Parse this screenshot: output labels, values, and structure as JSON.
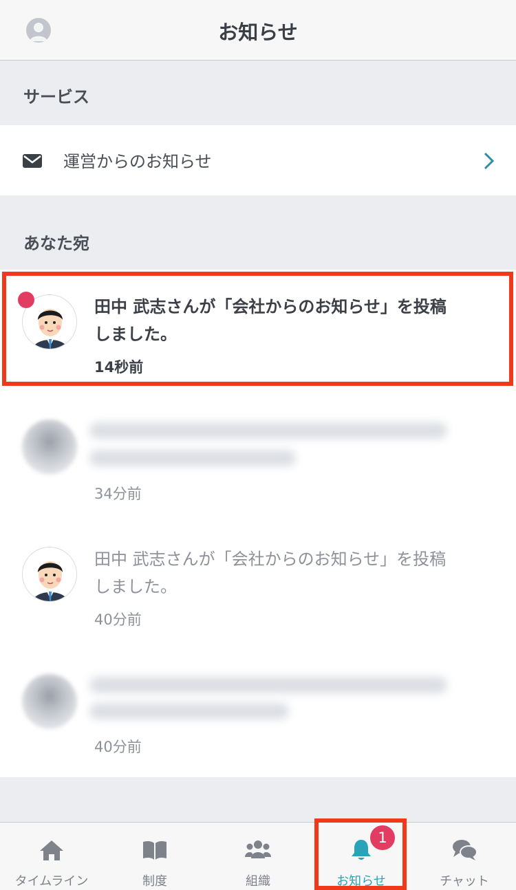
{
  "header": {
    "title": "お知らせ"
  },
  "sections": {
    "service": {
      "label": "サービス",
      "row_label": "運営からのお知らせ"
    },
    "mine": {
      "label": "あなた宛"
    }
  },
  "notifications": [
    {
      "text": "田中 武志さんが「会社からのお知らせ」を投稿しました。",
      "line1": "田中 武志さんが「会社からのお知らせ」を投稿",
      "line2": "しました。",
      "time": "14秒前",
      "unread": true
    },
    {
      "text": "",
      "time": "34分前",
      "unread": false,
      "blurred": true
    },
    {
      "text": "田中 武志さんが「会社からのお知らせ」を投稿しました。",
      "line1": "田中 武志さんが「会社からのお知らせ」を投稿",
      "line2": "しました。",
      "time": "40分前",
      "unread": false
    },
    {
      "text": "",
      "time": "40分前",
      "unread": false,
      "blurred": true
    }
  ],
  "tabbar": {
    "tabs": [
      {
        "label": "タイムライン",
        "icon": "home-icon"
      },
      {
        "label": "制度",
        "icon": "book-icon"
      },
      {
        "label": "組織",
        "icon": "group-icon"
      },
      {
        "label": "お知らせ",
        "icon": "bell-icon",
        "active": true,
        "badge": "1"
      },
      {
        "label": "チャット",
        "icon": "chat-icon"
      }
    ]
  },
  "colors": {
    "accent": "#2aa3b8",
    "badge": "#e23c63",
    "highlight": "#f0391b"
  }
}
